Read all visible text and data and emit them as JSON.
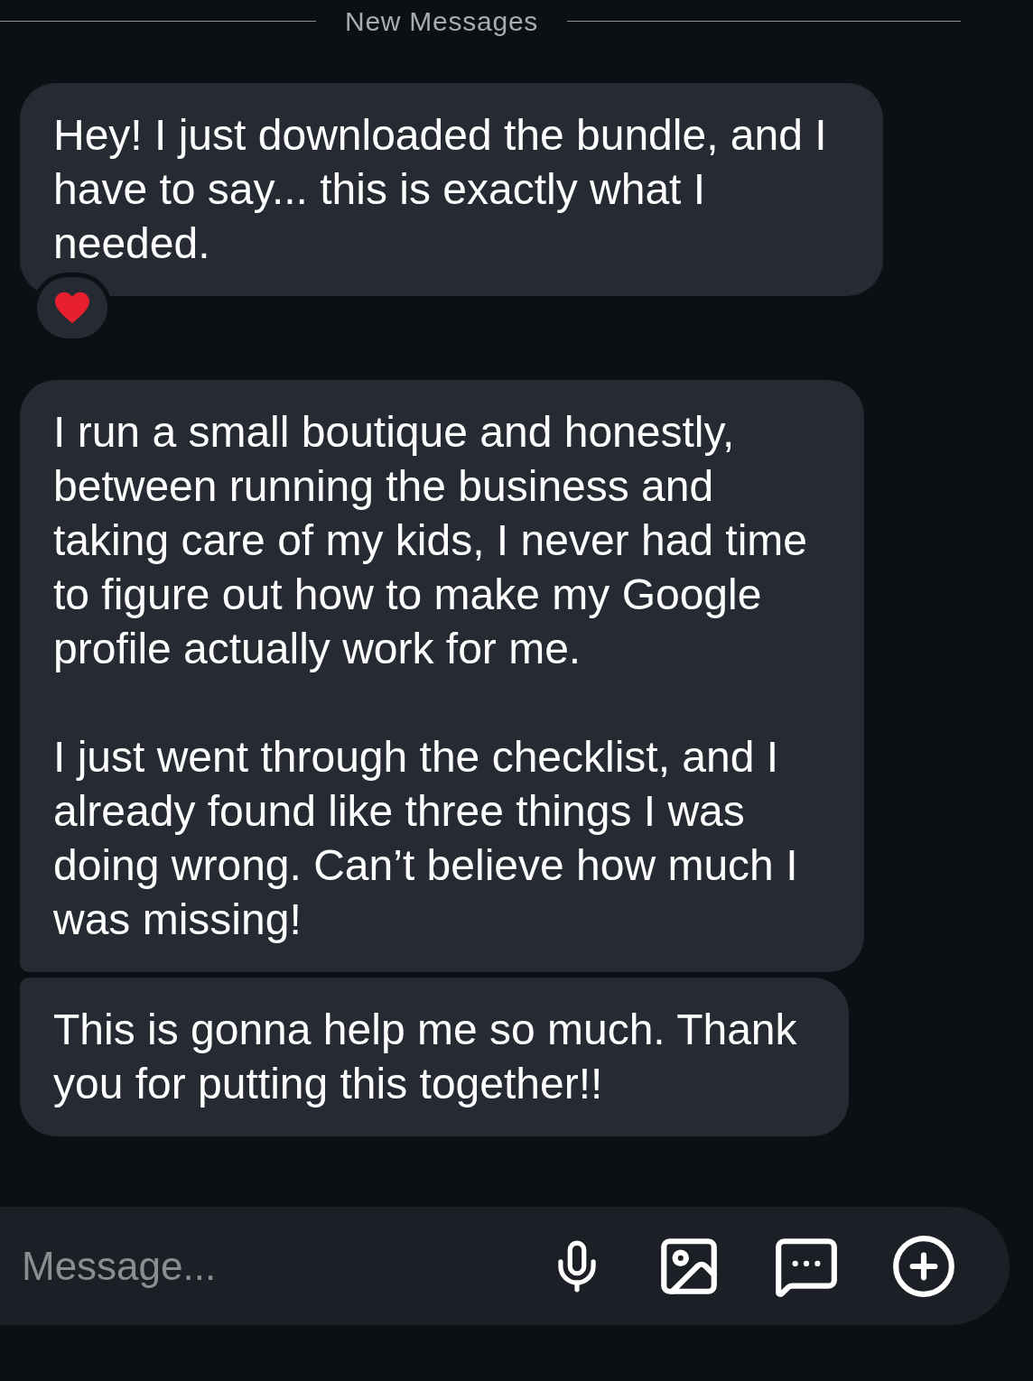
{
  "divider": {
    "label": "New Messages"
  },
  "messages": [
    {
      "paragraphs": [
        "Hey! I just downloaded the bundle, and I have to say... this is exactly what I needed."
      ],
      "reaction": true,
      "kind": "single"
    },
    {
      "paragraphs": [
        "I run a small boutique and honestly, between running the business and taking care of my kids, I never had time to figure out how to make my Google profile actually work for me.",
        "I just went through the checklist, and I already found like three things I was doing wrong. Can’t believe how much I was missing!"
      ],
      "reaction": false,
      "kind": "first"
    },
    {
      "paragraphs": [
        "This is gonna help me so much. Thank you for putting this together!!"
      ],
      "reaction": false,
      "kind": "last"
    }
  ],
  "composer": {
    "placeholder": "Message..."
  }
}
